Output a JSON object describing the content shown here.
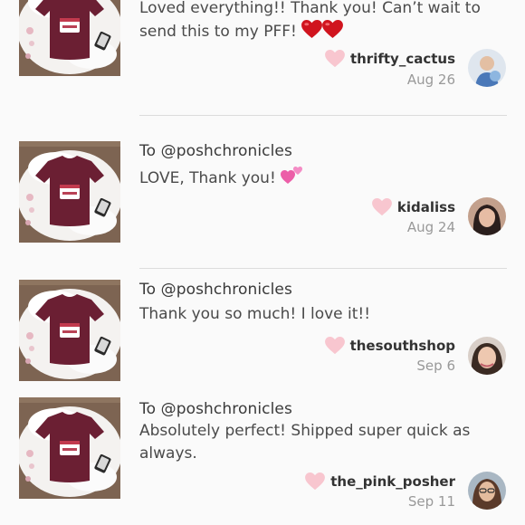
{
  "comments": [
    {
      "to": "",
      "message": "Loved everything!! Thank you! Can’t wait to send this to my PFF!",
      "message_line1": "Loved everything!! Thank you! Can’t wait to",
      "message_line2": "send this to my PFF!",
      "emoji": "red-heart-icon x2",
      "username": "thrifty_cactus",
      "date": "Aug 26"
    },
    {
      "to": "To @poshchronicles",
      "message": "LOVE, Thank you!",
      "emoji": "two-hearts-icon",
      "username": "kidaliss",
      "date": "Aug 24"
    },
    {
      "to": "To @poshchronicles",
      "message": "Thank you so much! I love it!!",
      "username": "thesouthshop",
      "date": "Sep 6"
    },
    {
      "to": "To @poshchronicles",
      "message_line1": "Absolutely perfect! Shipped super quick as",
      "message_line2": "always.",
      "username": "the_pink_posher",
      "date": "Sep 11"
    }
  ],
  "colors": {
    "like_heart": "#f8c6cf",
    "shirt": "#6b1f33",
    "divider": "#dcdcdc"
  }
}
